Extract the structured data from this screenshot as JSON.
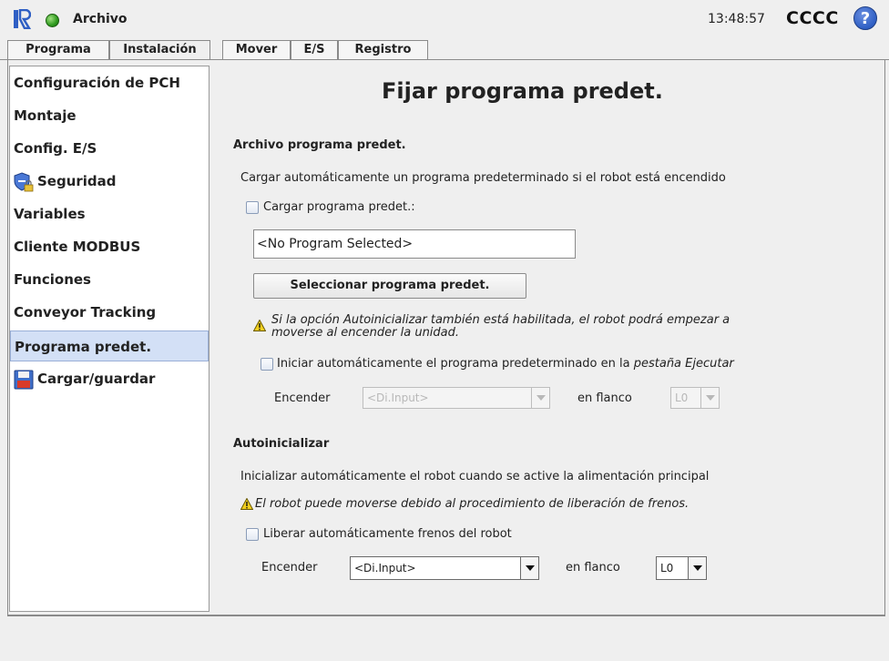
{
  "header": {
    "logo_icon": "ur-logo-icon",
    "status_color": "#2e9a1e",
    "title": "Archivo",
    "time": "13:48:57",
    "robot_name": "CCCC",
    "help_label": "?"
  },
  "tabs": [
    {
      "label": "Programa"
    },
    {
      "label": "Instalación",
      "active": true
    },
    {
      "label": "Mover"
    },
    {
      "label": "E/S"
    },
    {
      "label": "Registro"
    }
  ],
  "sidebar": {
    "items": [
      {
        "label": "Configuración de PCH"
      },
      {
        "label": "Montaje"
      },
      {
        "label": "Config. E/S"
      },
      {
        "label": "Seguridad",
        "icon": "shield-lock-icon"
      },
      {
        "label": "Variables"
      },
      {
        "label": "Cliente MODBUS"
      },
      {
        "label": "Funciones"
      },
      {
        "label": "Conveyor Tracking"
      },
      {
        "label": "Programa predet.",
        "selected": true
      },
      {
        "label": "Cargar/guardar",
        "icon": "floppy-disk-icon"
      }
    ]
  },
  "main": {
    "title": "Fijar programa predet.",
    "default_program": {
      "heading": "Archivo programa predet.",
      "description": "Cargar automáticamente un programa predeterminado si el robot está encendido",
      "load_checkbox_label": "Cargar programa predet.:",
      "load_checked": false,
      "program_field_value": "<No Program Selected>",
      "select_button_label": "Seleccionar programa predet.",
      "warning_part1": "Si la opción Autoinicializar también está habilitada, el robot podrá empezar a",
      "warning_part2": "moverse al encender la unidad.",
      "autostart_label_part1": "Iniciar automáticamente el programa predeterminado en la ",
      "autostart_label_part2": "pestaña Ejecutar",
      "autostart_checked": false,
      "power_label": "Encender",
      "power_input_value": "<Di.Input>",
      "edge_label": "en flanco",
      "edge_value": "L0"
    },
    "autoinit": {
      "heading": "Autoinicializar",
      "description": "Inicializar automáticamente el robot cuando se active la alimentación principal",
      "warning": "El robot puede moverse debido al procedimiento de liberación de frenos.",
      "release_label": "Liberar automáticamente frenos del robot",
      "release_checked": false,
      "power_label": "Encender",
      "power_input_value": "<Di.Input>",
      "edge_label": "en flanco",
      "edge_value": "L0"
    }
  }
}
